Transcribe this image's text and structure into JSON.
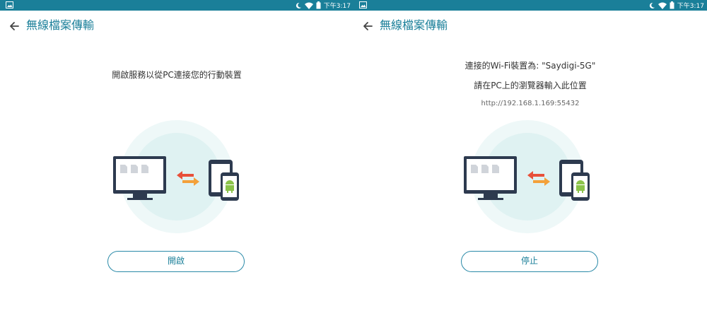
{
  "status_bar": {
    "time": "下午3:17"
  },
  "app": {
    "title": "無線檔案傳輸"
  },
  "left_screen": {
    "message": "開啟服務以從PC連接您的行動裝置",
    "button_label": "開啟"
  },
  "right_screen": {
    "connected_line": "連接的Wi-Fi裝置為: \"Saydigi-5G\"",
    "instruction_line": "請在PC上的瀏覽器輸入此位置",
    "url": "http://192.168.1.169:55432",
    "button_label": "停止"
  },
  "colors": {
    "accent": "#1a7f99",
    "circle": "#dff2f2",
    "monitor": "#2d3a4f",
    "arrow_red": "#e8503a",
    "arrow_orange": "#f3a13a",
    "android": "#8bc34a"
  },
  "icons": [
    "gallery-icon",
    "moon-icon",
    "wifi-icon",
    "battery-icon",
    "back-arrow-icon",
    "monitor-icon",
    "transfer-arrows-icon",
    "tablet-icon",
    "phone-icon",
    "android-icon",
    "file-icon"
  ]
}
